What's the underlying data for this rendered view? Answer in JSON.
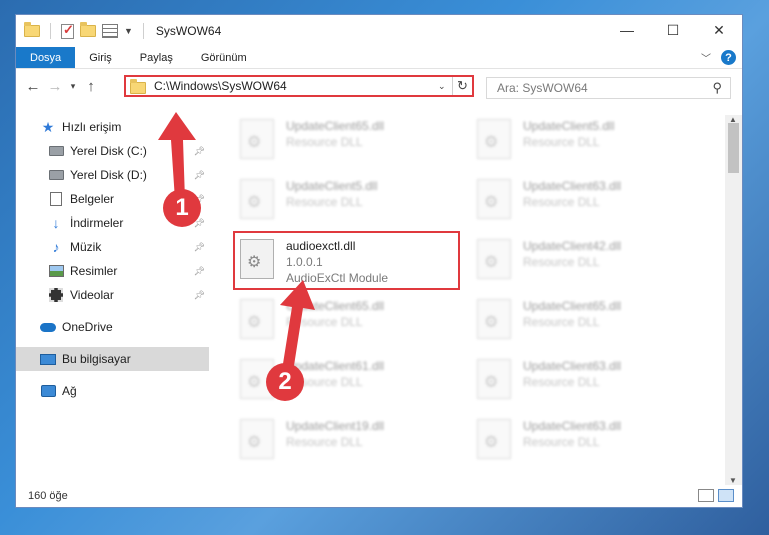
{
  "window": {
    "title": "SysWOW64"
  },
  "ribbon": {
    "tabs": [
      {
        "label": "Dosya"
      },
      {
        "label": "Giriş"
      },
      {
        "label": "Paylaş"
      },
      {
        "label": "Görünüm"
      }
    ],
    "help": "?"
  },
  "address": {
    "path": "C:\\Windows\\SysWOW64",
    "search_placeholder": "Ara: SysWOW64"
  },
  "navpane": {
    "items": [
      {
        "label": "Hızlı erişim",
        "icon": "star-icon"
      },
      {
        "label": "Yerel Disk (C:)",
        "icon": "disk-icon"
      },
      {
        "label": "Yerel Disk (D:)",
        "icon": "disk-icon"
      },
      {
        "label": "Belgeler",
        "icon": "documents-icon"
      },
      {
        "label": "İndirmeler",
        "icon": "download-icon"
      },
      {
        "label": "Müzik",
        "icon": "music-icon"
      },
      {
        "label": "Resimler",
        "icon": "pictures-icon"
      },
      {
        "label": "Videolar",
        "icon": "videos-icon"
      },
      {
        "label": "OneDrive",
        "icon": "onedrive-icon"
      },
      {
        "label": "Bu bilgisayar",
        "icon": "computer-icon"
      },
      {
        "label": "Ağ",
        "icon": "network-icon"
      }
    ]
  },
  "files": {
    "left": [
      {
        "name": "UpdateClient65.dll",
        "sub": "Resource DLL"
      },
      {
        "name": "UpdateClient5.dll",
        "sub": "Resource DLL"
      },
      {
        "name": "UpdateClient65.dll",
        "sub": "Resource DLL"
      },
      {
        "name": "UpdateClient61.dll",
        "sub": "Resource DLL"
      },
      {
        "name": "UpdateClient19.dll",
        "sub": "Resource DLL"
      }
    ],
    "right": [
      {
        "name": "UpdateClient5.dll",
        "sub": "Resource DLL"
      },
      {
        "name": "UpdateClient63.dll",
        "sub": "Resource DLL"
      },
      {
        "name": "UpdateClient42.dll",
        "sub": "Resource DLL"
      },
      {
        "name": "UpdateClient65.dll",
        "sub": "Resource DLL"
      },
      {
        "name": "UpdateClient63.dll",
        "sub": "Resource DLL"
      },
      {
        "name": "UpdateClient63.dll",
        "sub": "Resource DLL"
      }
    ],
    "highlighted": {
      "name": "audioexctl.dll",
      "version": "1.0.0.1",
      "description": "AudioExCtl Module"
    }
  },
  "status": {
    "count": "160 öğe"
  },
  "annotations": {
    "step1": "1",
    "step2": "2",
    "color": "#e0393e"
  }
}
